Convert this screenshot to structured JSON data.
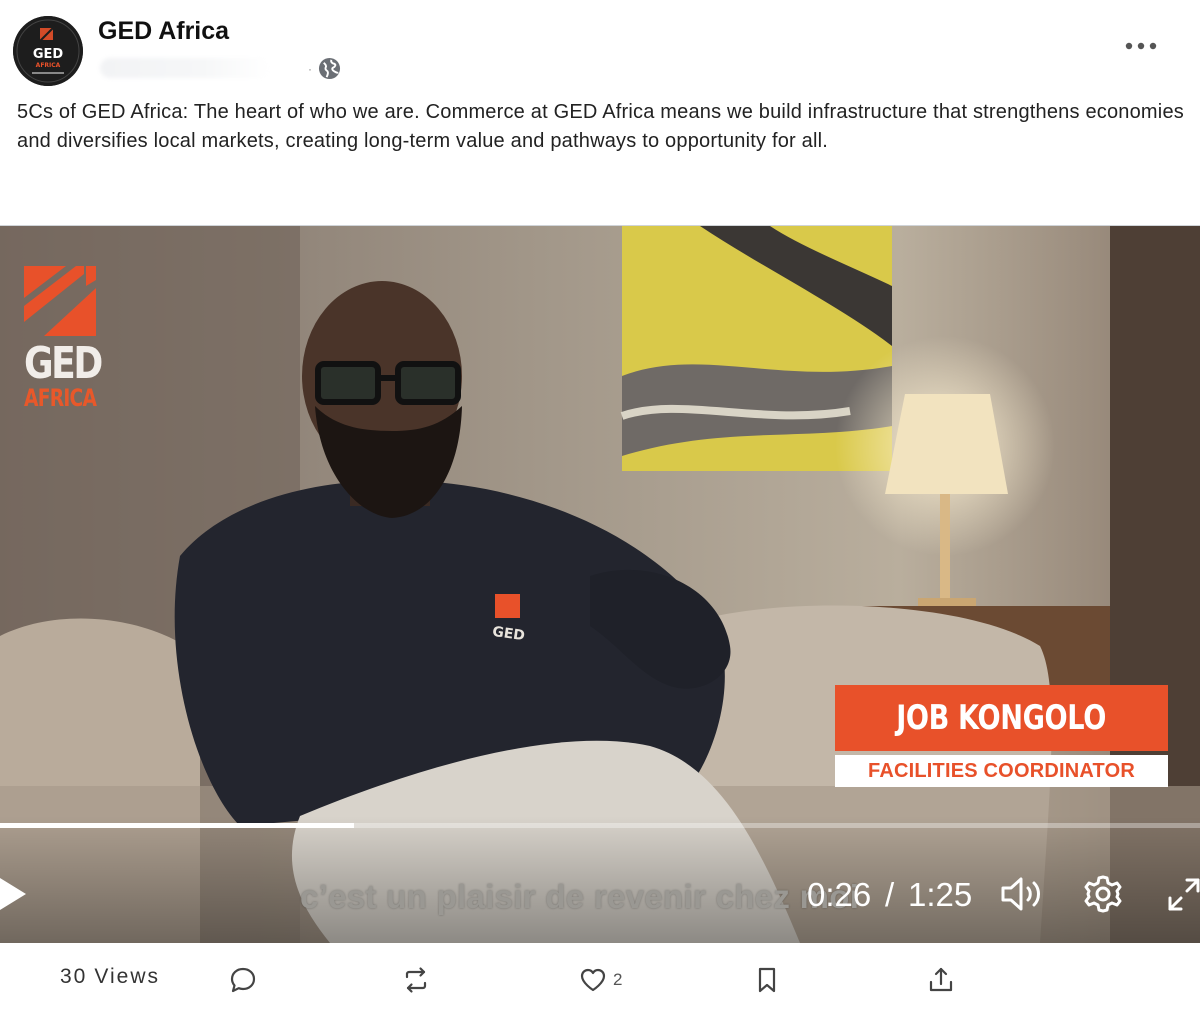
{
  "author": {
    "name": "GED Africa",
    "avatar_text": "GED",
    "avatar_subtext": "AFRICA"
  },
  "caption": "5Cs of GED Africa: The heart of who we are. Commerce at GED Africa means we build infrastructure that strengthens economies and diversifies local markets, creating long-term value and pathways to opportunity for all.",
  "icons": {
    "visibility": "globe-icon",
    "menu": "more-options-icon",
    "play": "play-icon",
    "volume": "volume-icon",
    "settings": "gear-icon",
    "fullscreen": "fullscreen-icon",
    "reply": "comment-icon",
    "repost": "repost-icon",
    "like": "heart-icon",
    "bookmark": "bookmark-icon",
    "share": "share-icon"
  },
  "video": {
    "overlay_brand": "GED",
    "overlay_brand_sub": "AFRICA",
    "shirt_logo": "GED",
    "lower_third_name": "JOB KONGOLO",
    "lower_third_role": "FACILITIES COORDINATOR",
    "subtitle": "c’est un plaisir de revenir chez moi",
    "time_current": "0:26",
    "time_separator": "/",
    "time_total": "1:25",
    "progress": 0.295
  },
  "actions": {
    "views_count": "30",
    "views_label": "Views",
    "likes_count": "2"
  },
  "colors": {
    "brand_orange": "#e8512a",
    "text": "#222222",
    "muted": "#555555"
  }
}
